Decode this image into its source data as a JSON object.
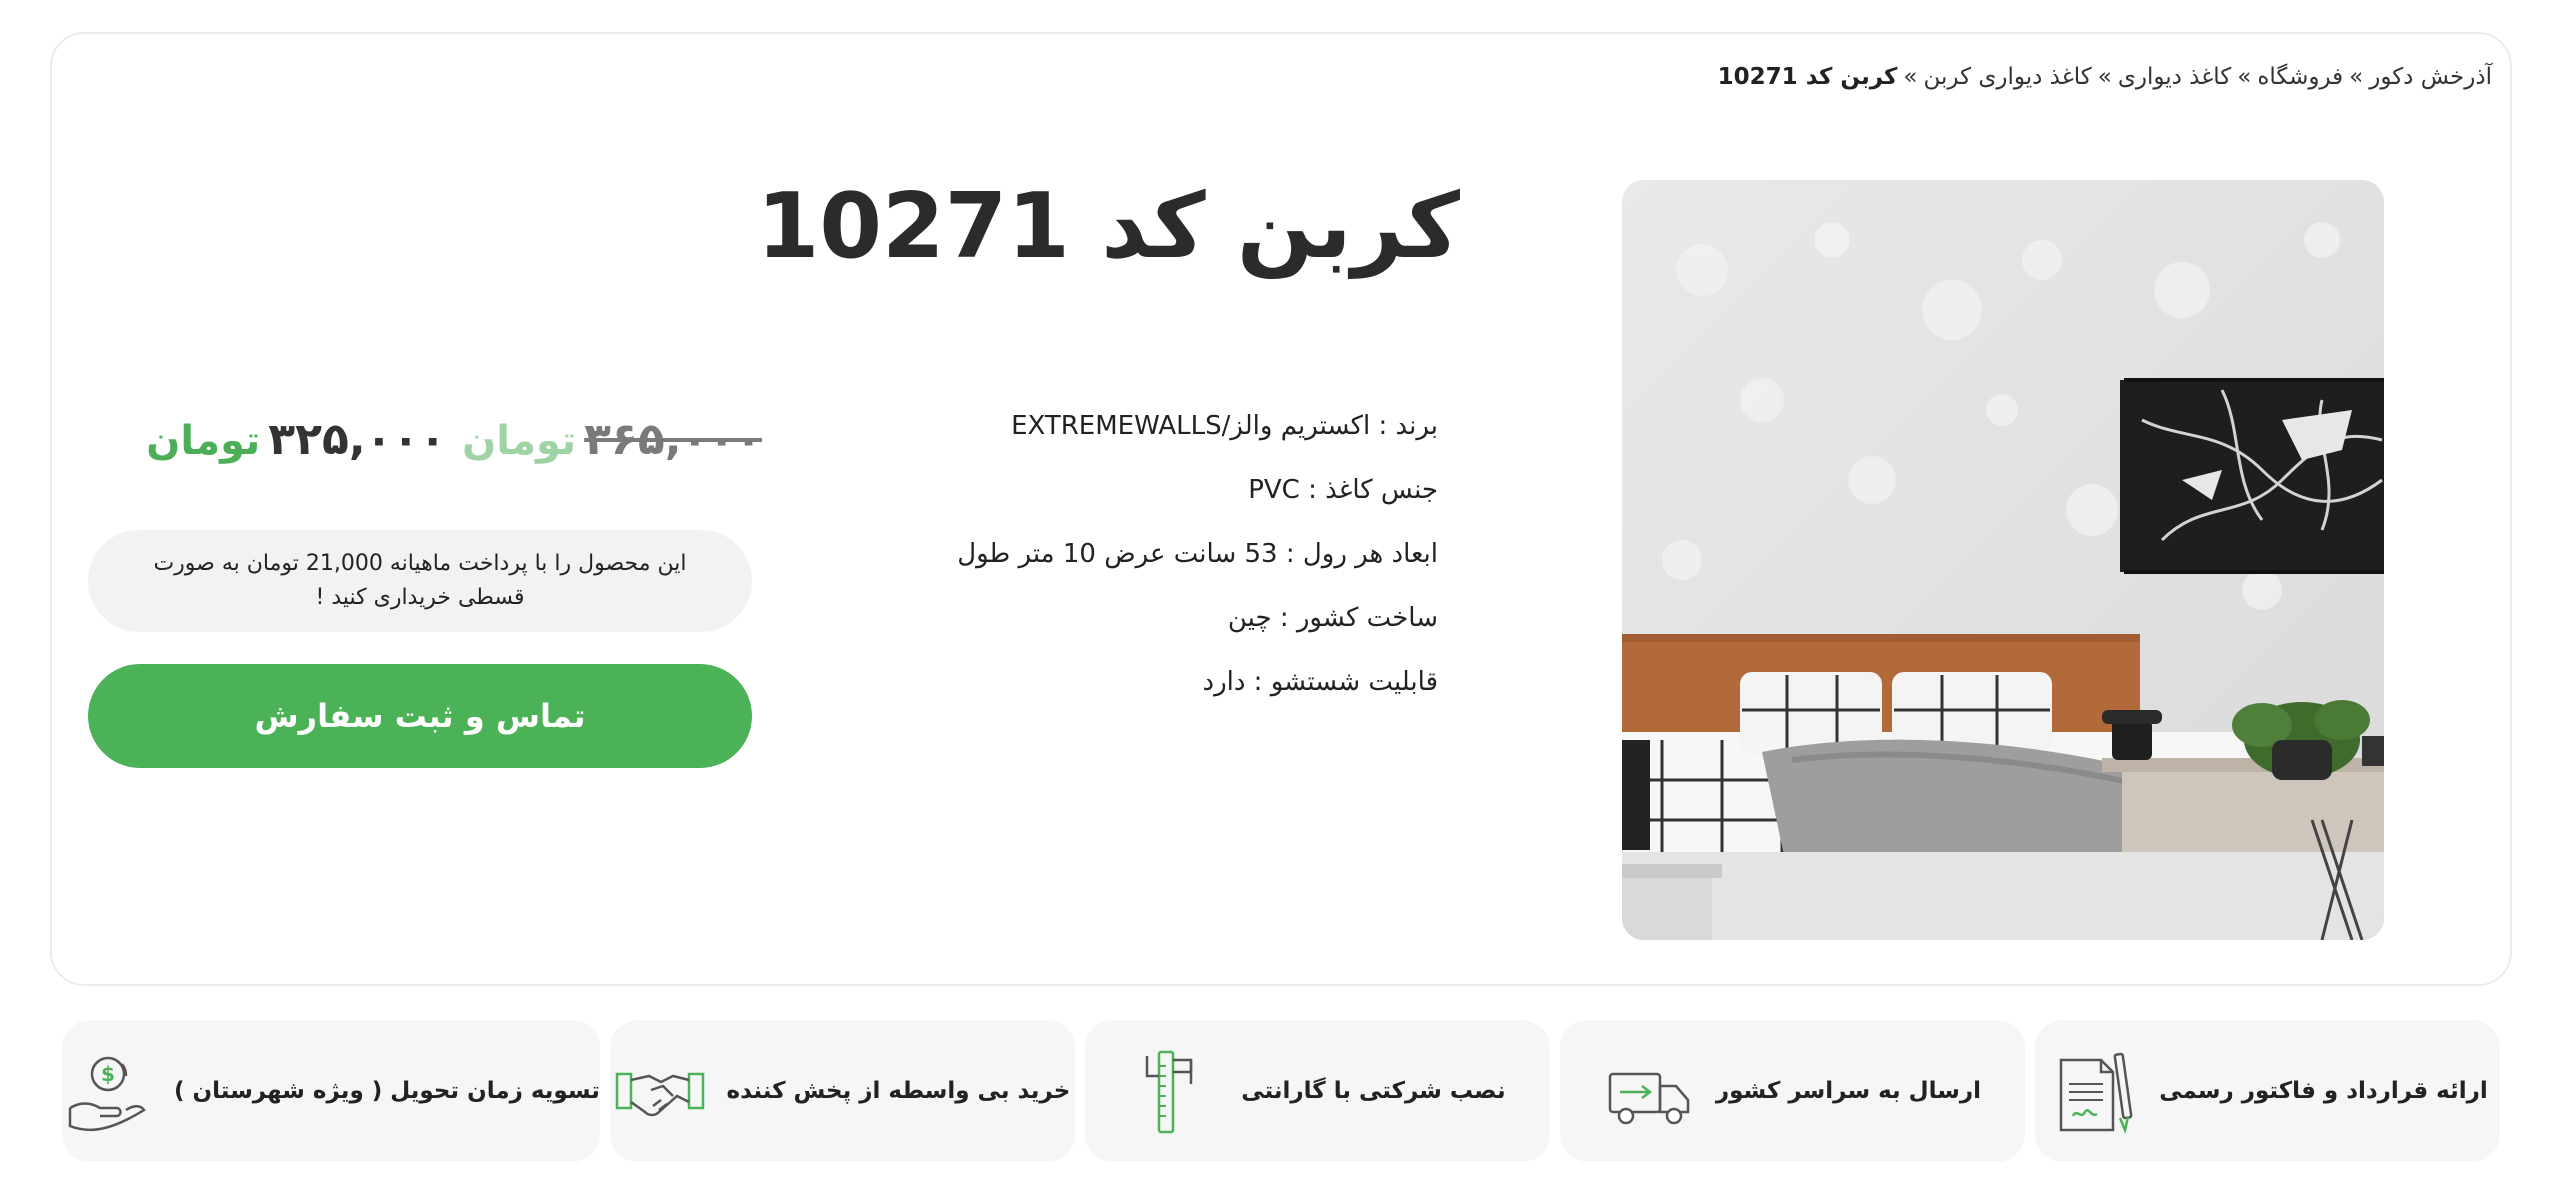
{
  "breadcrumb": {
    "items": [
      "آذرخش دکور",
      "فروشگاه",
      "کاغذ دیواری",
      "کاغذ دیواری کربن"
    ],
    "separator": "»",
    "current": "کربن کد 10271"
  },
  "product": {
    "title": "کربن کد 10271",
    "specs": [
      "برند : اکستریم والز/EXTREMEWALLS",
      "جنس کاغذ : PVC",
      "ابعاد هر رول : 53 سانت عرض 10 متر طول",
      "ساخت کشور : چین",
      "قابلیت شستشو : دارد"
    ]
  },
  "price": {
    "old": "۳۶۵,۰۰۰",
    "old_currency": "تومان",
    "new": "۳۲۵,۰۰۰",
    "new_currency": "تومان"
  },
  "installment_text": "این محصول را با پرداخت ماهیانه 21,000 تومان به صورت قسطی خریداری کنید !",
  "order_button": "تماس و ثبت سفارش",
  "features": [
    {
      "label": "ارائه قرارداد و فاکتور رسمی",
      "icon": "contract-icon"
    },
    {
      "label": "ارسال به سراسر کشور",
      "icon": "delivery-truck-icon"
    },
    {
      "label": "نصب شرکتی با گارانتی",
      "icon": "installation-tools-icon"
    },
    {
      "label": "خرید بی واسطه از پخش کننده",
      "icon": "handshake-icon"
    },
    {
      "label": "تسویه زمان تحویل ( ویژه شهرستان )",
      "icon": "payment-hand-icon"
    }
  ],
  "colors": {
    "accent_green": "#4cb257",
    "currency_green": "#4cae57",
    "old_currency_green": "#9fd3a4",
    "pill_gray": "#f2f2f2"
  }
}
